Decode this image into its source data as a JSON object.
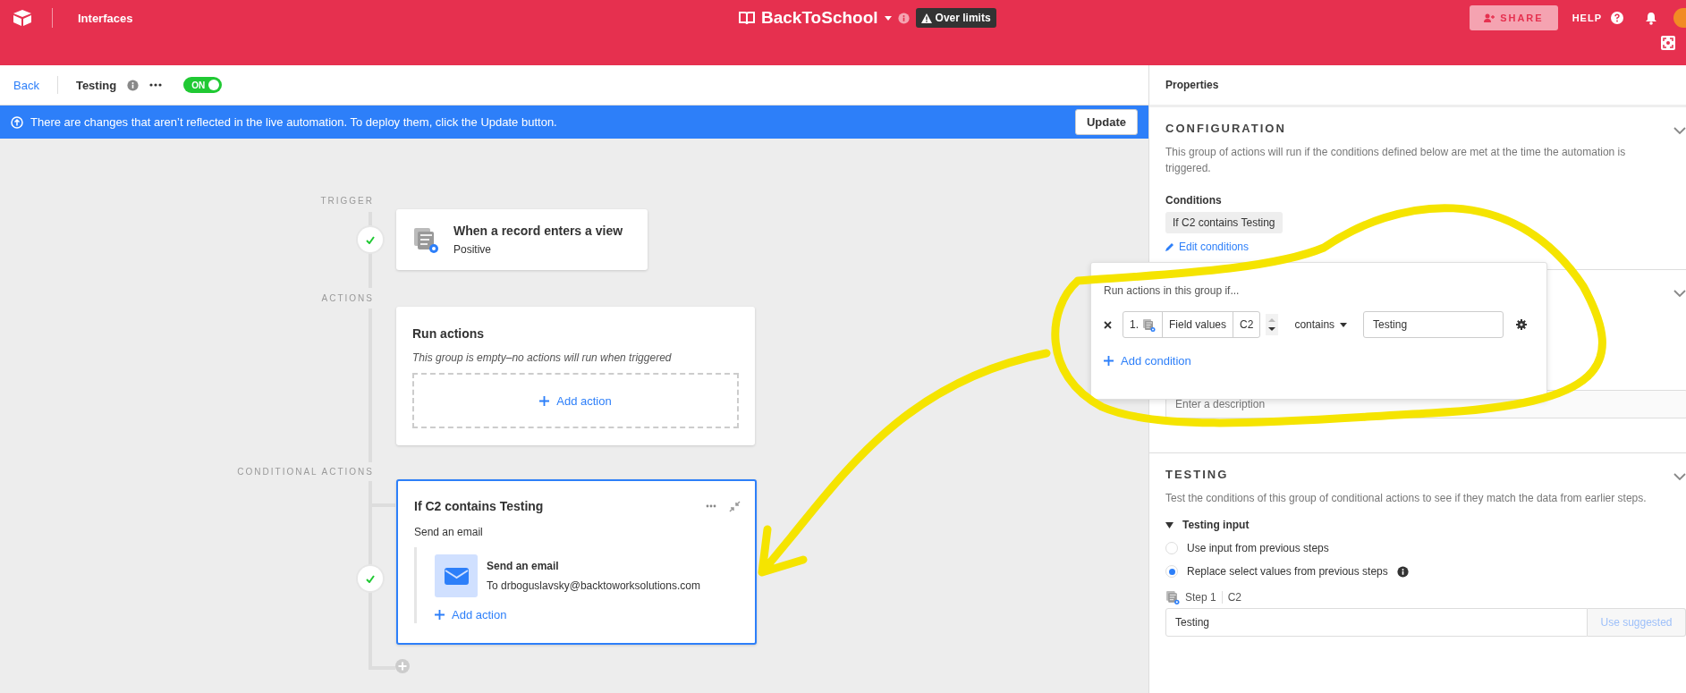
{
  "topbar": {
    "section": "Interfaces",
    "base_name": "BackToSchool",
    "badge": "Over limits",
    "share": "SHARE",
    "help": "HELP"
  },
  "header": {
    "back": "Back",
    "title": "Testing",
    "toggle": {
      "label": "ON",
      "on": true
    }
  },
  "banner": {
    "message": "There are changes that aren’t reflected in the live automation. To deploy them, click the Update button.",
    "button": "Update"
  },
  "canvas": {
    "trigger_label": "TRIGGER",
    "trigger": {
      "title": "When a record enters a view",
      "subtitle": "Positive"
    },
    "actions_label": "ACTIONS",
    "run_actions": {
      "title": "Run actions",
      "empty_note": "This group is empty–no actions will run when triggered",
      "add_action": "Add action"
    },
    "conditional_label": "CONDITIONAL ACTIONS",
    "conditional": {
      "title": "If C2 contains Testing",
      "subtitle": "Send an email",
      "selected": true,
      "action": {
        "title": "Send an email",
        "detail": "To drboguslavsky@backtoworksolutions.com"
      },
      "add_action": "Add action"
    }
  },
  "properties": {
    "title": "Properties",
    "configuration": {
      "heading": "CONFIGURATION",
      "text": "This group of actions will run if the conditions defined below are met at the time the automation is triggered.",
      "conditions_label": "Conditions",
      "condition_pill": "If C2 contains Testing",
      "edit_link": "Edit conditions"
    },
    "description_field": {
      "placeholder": "Enter a description"
    },
    "testing": {
      "heading": "TESTING",
      "text": "Test the conditions of this group of conditional actions to see if they match the data from earlier steps.",
      "input_heading": "Testing input",
      "expanded": true,
      "options": [
        {
          "label": "Use input from previous steps",
          "selected": false
        },
        {
          "label": "Replace select values from previous steps",
          "selected": true
        }
      ],
      "step": "Step 1",
      "field": "C2",
      "value": "Testing",
      "suggest": "Use suggested"
    }
  },
  "popup": {
    "title": "Run actions in this group if...",
    "condition": {
      "index": "1.",
      "source": "Field values",
      "field": "C2",
      "operator": "contains",
      "value": "Testing"
    },
    "add": "Add condition"
  }
}
